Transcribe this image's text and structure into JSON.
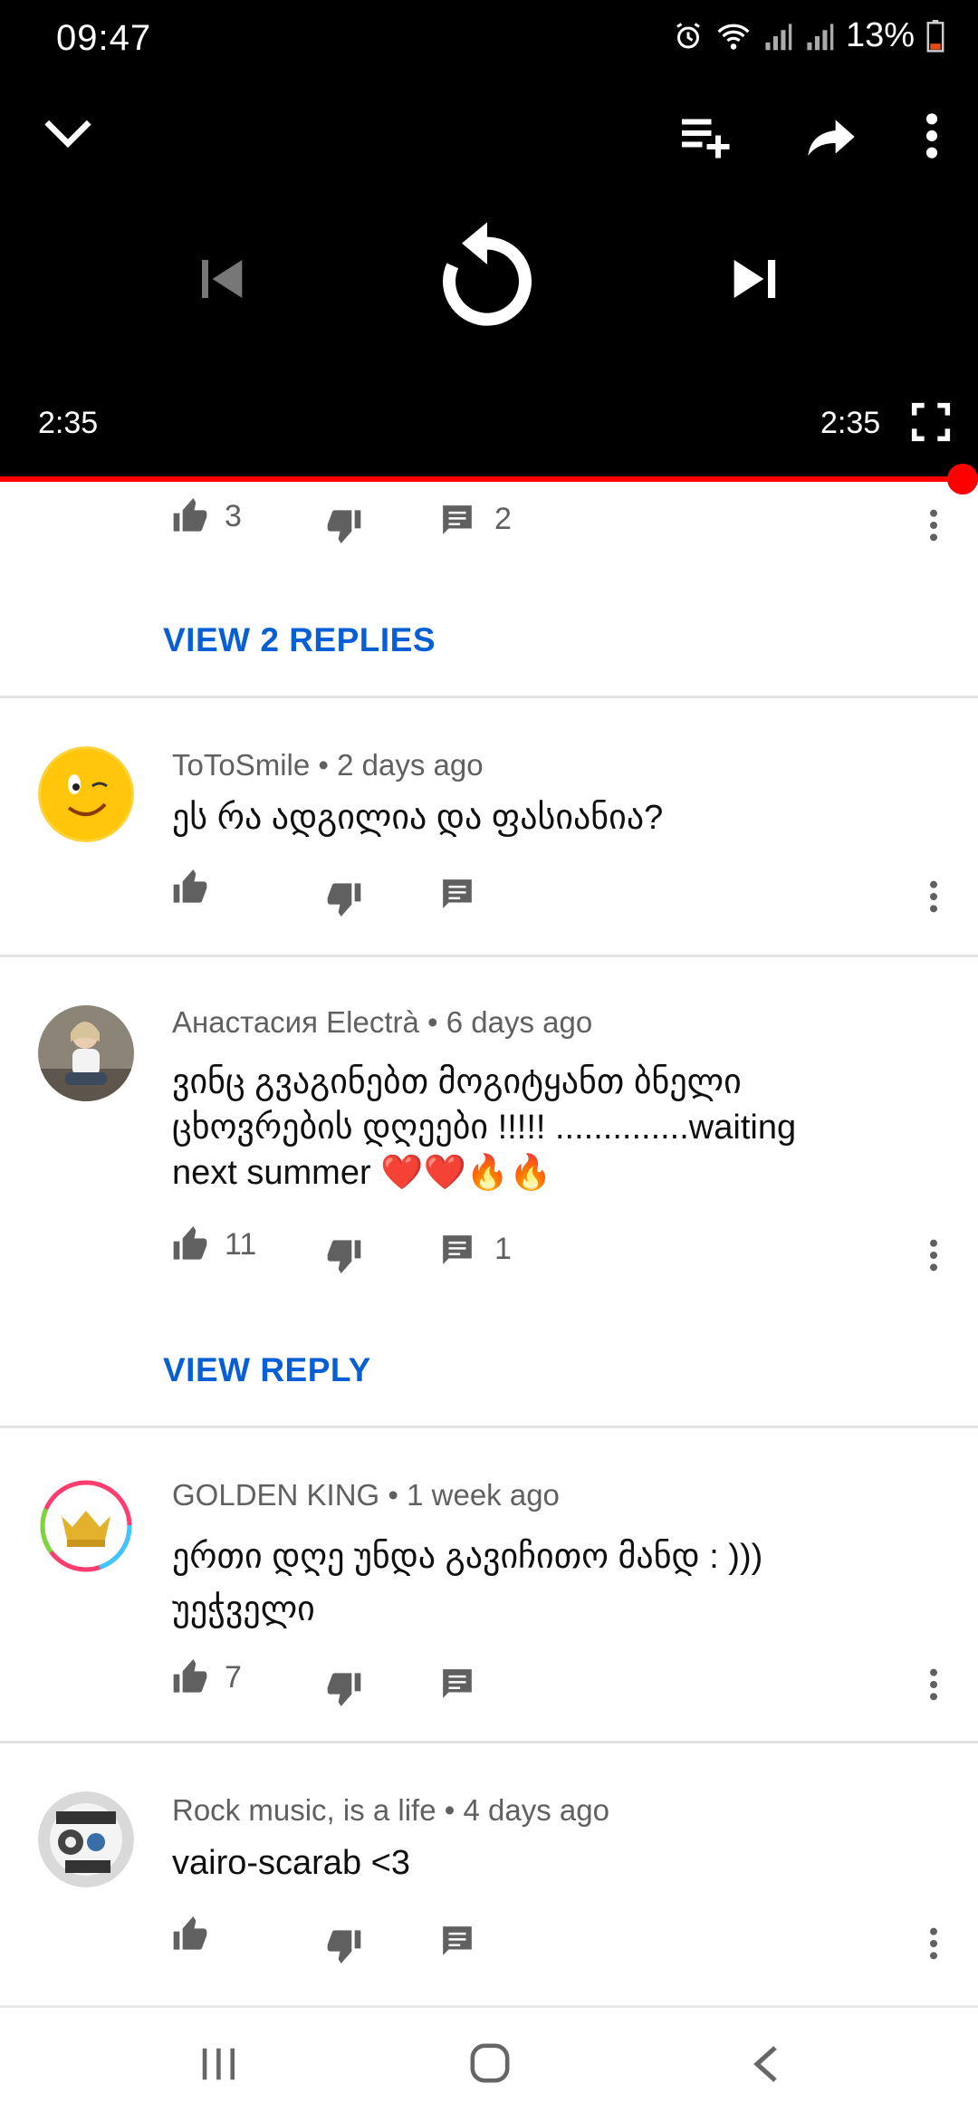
{
  "status": {
    "time": "09:47",
    "battery": "13%"
  },
  "player": {
    "elapsed": "2:35",
    "duration": "2:35",
    "progress_fraction": 1.0,
    "accent": "#ff0000"
  },
  "top_partial": {
    "likes": "3",
    "replies_count": "2",
    "view_replies": "VIEW 2 REPLIES"
  },
  "comments": [
    {
      "author": "ToToSmile",
      "age": "2 days ago",
      "text": "ეს რა ადგილია და ფასიანია?",
      "likes": "",
      "replies": ""
    },
    {
      "author": "Анастасия Electrà",
      "age": "6 days ago",
      "text_line1": "ვინც გვაგინებთ მოგიტყანთ ბნელი",
      "text_line2": "ცხოვრების დღეები !!!!!   ..............waiting",
      "text_line3": "next summer ",
      "emoji": "❤️❤️🔥🔥",
      "likes": "11",
      "replies": "1",
      "view_reply": "VIEW REPLY"
    },
    {
      "author": "GOLDEN KING",
      "age": "1 week ago",
      "text_line1": "ერთი დღე უნდა გავიჩითო მანდ : )))",
      "text_line2": "უეჭველი",
      "likes": "7",
      "replies": ""
    },
    {
      "author": "Rock music, is a life",
      "age": "4 days ago",
      "text": "vairo-scarab <3",
      "likes": "",
      "replies": ""
    }
  ],
  "separator": " • ",
  "colors": {
    "link": "#065fd4",
    "meta": "#606060",
    "divider": "#e3e3e3"
  }
}
